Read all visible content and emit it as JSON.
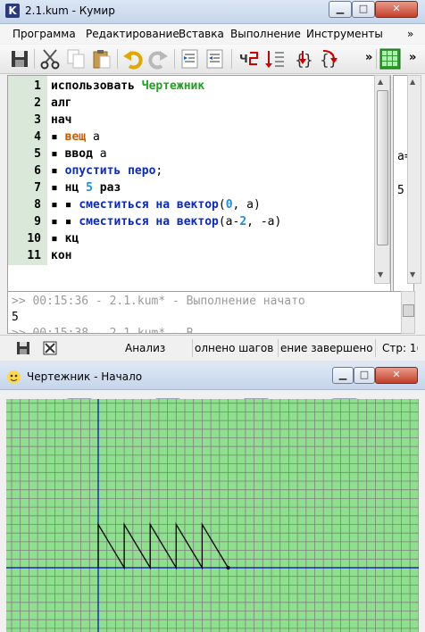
{
  "main_window": {
    "title": "2.1.kum - Кумир",
    "app_icon_letter": "K",
    "menu": [
      "Программа",
      "Редактирование",
      "Вставка",
      "Выполнение",
      "Инструменты"
    ],
    "menu_overflow": "»",
    "toolbar_overflow": "»",
    "toolbar_icons": [
      "save-icon",
      "cut-icon",
      "copy-icon",
      "paste-icon",
      "undo-icon",
      "redo-icon",
      "indent-icon",
      "unindent-icon",
      "run-icon",
      "step-icon",
      "step-into-icon",
      "step-out-icon",
      "grid-icon"
    ]
  },
  "editor": {
    "lines": [
      {
        "n": "1",
        "parts": [
          {
            "t": "использовать ",
            "c": "kw"
          },
          {
            "t": "Чертежник",
            "c": "green"
          }
        ]
      },
      {
        "n": "2",
        "parts": [
          {
            "t": "алг",
            "c": "kw"
          }
        ]
      },
      {
        "n": "3",
        "parts": [
          {
            "t": "нач",
            "c": "kw"
          }
        ]
      },
      {
        "n": "4",
        "parts": [
          {
            "t": "▪ ",
            "c": "kw"
          },
          {
            "t": "вещ",
            "c": "orange"
          },
          {
            "t": " а",
            "c": "plain"
          }
        ]
      },
      {
        "n": "5",
        "parts": [
          {
            "t": "▪ ",
            "c": "kw"
          },
          {
            "t": "ввод",
            "c": "kw"
          },
          {
            "t": " а",
            "c": "plain"
          }
        ]
      },
      {
        "n": "6",
        "parts": [
          {
            "t": "▪ ",
            "c": "kw"
          },
          {
            "t": "опустить перо",
            "c": "blue"
          },
          {
            "t": ";",
            "c": "plain"
          }
        ]
      },
      {
        "n": "7",
        "parts": [
          {
            "t": "▪ ",
            "c": "kw"
          },
          {
            "t": "нц ",
            "c": "kw"
          },
          {
            "t": "5",
            "c": "num"
          },
          {
            "t": " раз",
            "c": "kw"
          }
        ]
      },
      {
        "n": "8",
        "parts": [
          {
            "t": "▪ ▪ ",
            "c": "kw"
          },
          {
            "t": "сместиться на вектор",
            "c": "blue"
          },
          {
            "t": "(",
            "c": "plain"
          },
          {
            "t": "0",
            "c": "num"
          },
          {
            "t": ", а)",
            "c": "plain"
          }
        ]
      },
      {
        "n": "9",
        "parts": [
          {
            "t": "▪ ▪ ",
            "c": "kw"
          },
          {
            "t": "сместиться на вектор",
            "c": "blue"
          },
          {
            "t": "(а-",
            "c": "plain"
          },
          {
            "t": "2",
            "c": "num"
          },
          {
            "t": ", -а)",
            "c": "plain"
          }
        ]
      },
      {
        "n": "10",
        "parts": [
          {
            "t": "▪ ",
            "c": "kw"
          },
          {
            "t": "кц",
            "c": "kw"
          }
        ]
      },
      {
        "n": "11",
        "parts": [
          {
            "t": "кон",
            "c": "kw"
          }
        ]
      }
    ],
    "side_values": {
      "line5": "а=",
      "line7": "5"
    }
  },
  "console": {
    "line1": ">> 00:15:36 - 2.1.kum* - Выполнение начато",
    "line2": "5",
    "line3": ">> 00:15:38 - 2.1.kum* - В"
  },
  "statusbar": {
    "mode": "Анализ",
    "steps": "олнено шагов",
    "result": "ение завершено",
    "position": "Стр: 1("
  },
  "drawer_window": {
    "title": "Чертежник - Начало",
    "tools": [
      "zoom-in-icon",
      "zoom-out-icon",
      "grid-dots-icon",
      "fit-view-icon"
    ]
  },
  "drawing": {
    "grid_color": "#8ee08e",
    "line_color": "#808080",
    "axis_color": "#0000cc",
    "input_a": 5,
    "teeth": 5
  }
}
